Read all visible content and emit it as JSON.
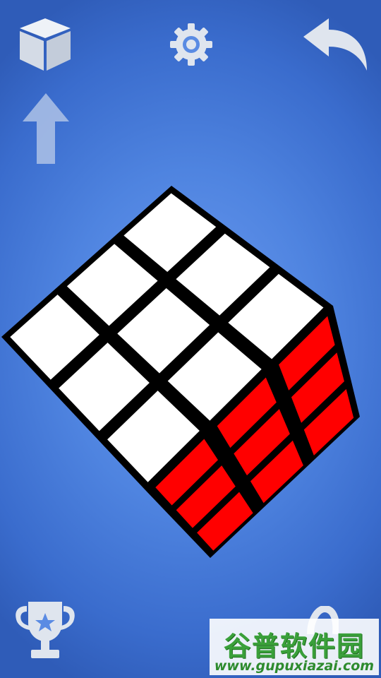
{
  "toolbar": {
    "view_icon": "cube-icon",
    "settings_icon": "gear-icon",
    "undo_icon": "undo-arrow-icon",
    "rotate_up_icon": "arrow-up-icon",
    "achievements_icon": "trophy-icon"
  },
  "cube": {
    "top_face_color": "#ffffff",
    "front_face_color": "#ff0000",
    "edge_color": "#000000",
    "grid_size": 3
  },
  "watermark": {
    "title": "谷普软件园",
    "url": "www.gupuxiazai.com"
  },
  "colors": {
    "background": "#4f84e0",
    "icon_fill": "#dfe5ee"
  }
}
